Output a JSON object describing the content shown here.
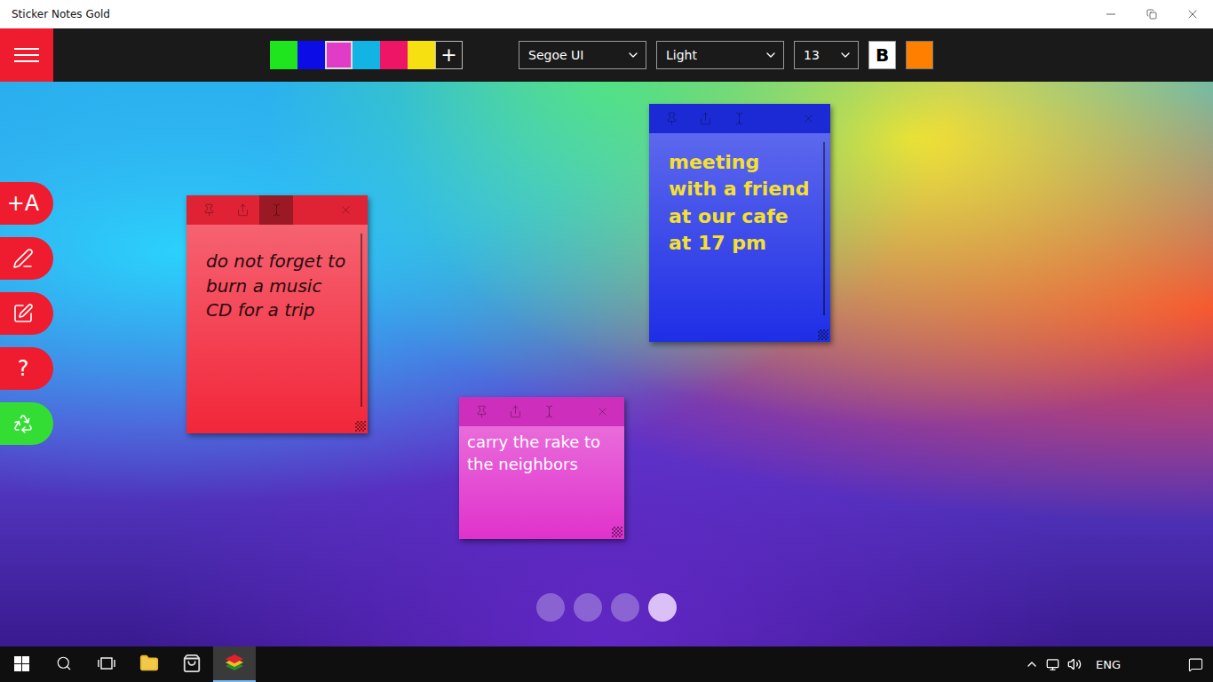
{
  "window": {
    "title": "Sticker Notes Gold"
  },
  "toolbar": {
    "colors": [
      {
        "color": "#1fe51f",
        "selected": false
      },
      {
        "color": "#0c0ce6",
        "selected": false
      },
      {
        "color": "#e03cc8",
        "selected": true
      },
      {
        "color": "#12b4e4",
        "selected": false
      },
      {
        "color": "#ee1466",
        "selected": false
      },
      {
        "color": "#f6e012",
        "selected": false
      }
    ],
    "add_color": "+",
    "font": "Segoe UI",
    "weight": "Light",
    "size": "13",
    "bold": {
      "label": "B",
      "on": true
    },
    "text_color": "#ff8000"
  },
  "side_buttons": [
    {
      "kind": "add-text",
      "label": "+A",
      "color": "#ee1c2e"
    },
    {
      "kind": "draw",
      "color": "#ee1c2e"
    },
    {
      "kind": "edit-desktop",
      "color": "#ee1c2e"
    },
    {
      "kind": "help",
      "label": "?",
      "color": "#ee1c2e"
    },
    {
      "kind": "share",
      "color": "#33dd33"
    }
  ],
  "notes": [
    {
      "text": "do not forget to burn a music CD for a trip",
      "color": "#f2263a",
      "text_color": "#2a0a0e",
      "italic": true,
      "bold": false,
      "tools": [
        {
          "kind": "pin",
          "selected": false
        },
        {
          "kind": "share",
          "selected": false
        },
        {
          "kind": "text",
          "selected": true
        },
        {
          "kind": "close",
          "selected": false
        }
      ]
    },
    {
      "text": "meeting with a friend at our cafe at 17 pm",
      "color": "#1e2ee6",
      "text_color": "#f4e030",
      "italic": false,
      "bold": true,
      "tools": [
        {
          "kind": "pin",
          "selected": false
        },
        {
          "kind": "share",
          "selected": false
        },
        {
          "kind": "text",
          "selected": false
        },
        {
          "kind": "close",
          "selected": false
        }
      ]
    },
    {
      "text": "carry the rake to the neighbors",
      "color": "#e032cc",
      "text_color": "#ffffff",
      "italic": false,
      "bold": false,
      "tools": [
        {
          "kind": "pin",
          "selected": false
        },
        {
          "kind": "share",
          "selected": false
        },
        {
          "kind": "text",
          "selected": false
        },
        {
          "kind": "close",
          "selected": false
        }
      ]
    }
  ],
  "pages": [
    {
      "selected": false
    },
    {
      "selected": false
    },
    {
      "selected": false
    },
    {
      "selected": true
    }
  ],
  "taskbar": {
    "apps": [
      {
        "kind": "explorer",
        "selected": false
      },
      {
        "kind": "store",
        "selected": false
      },
      {
        "kind": "sticker-notes",
        "selected": true
      }
    ],
    "language": "ENG"
  }
}
